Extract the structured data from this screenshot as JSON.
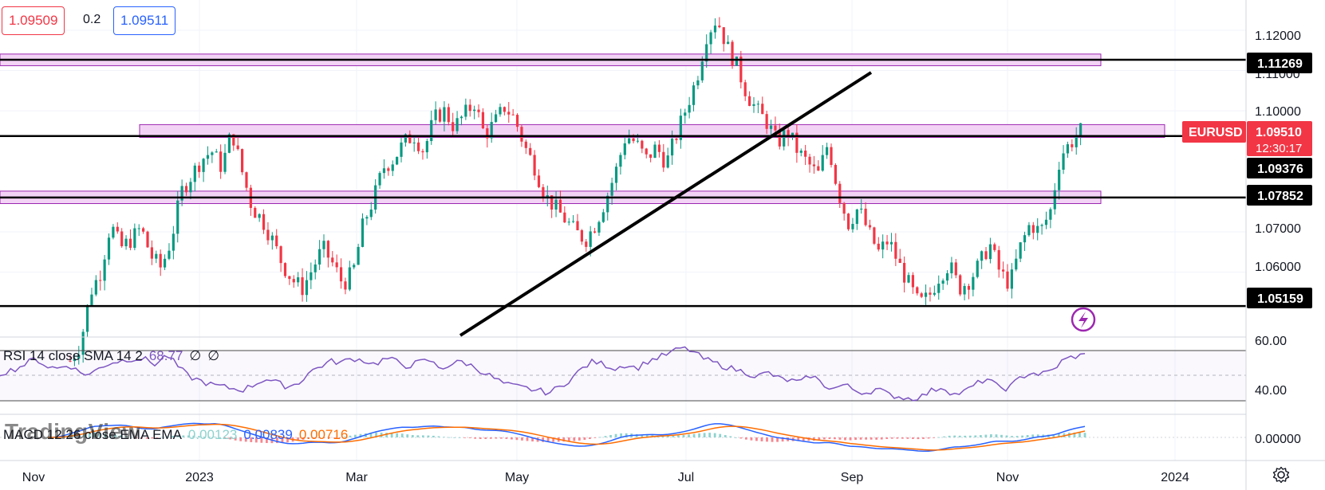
{
  "toolbar": {
    "sell_price": "1.09509",
    "spread": "0.2",
    "buy_price": "1.09511"
  },
  "price_axis": {
    "labels": [
      "1.12000",
      "1.11000",
      "1.10000",
      "1.07000",
      "1.06000"
    ],
    "levels": [
      {
        "value": "1.11269"
      },
      {
        "value": "1.09376"
      },
      {
        "value": "1.07852"
      },
      {
        "value": "1.05159"
      }
    ],
    "symbol_tag": "EURUSD",
    "current_price": "1.09510",
    "countdown": "12:30:17"
  },
  "time_axis": {
    "labels": [
      "Nov",
      "2023",
      "Mar",
      "May",
      "Jul",
      "Sep",
      "Nov",
      "2024"
    ]
  },
  "rsi": {
    "title": "RSI 14 close SMA 14 2",
    "value": "68.77",
    "extra1": "∅",
    "extra2": "∅",
    "axis_labels": [
      "60.00",
      "40.00"
    ]
  },
  "macd": {
    "title": "MACD 12 26 close EMA EMA",
    "hist_value": "0.00123",
    "macd_value": "0.00839",
    "signal_value": "0.00716",
    "axis_labels": [
      "0.00000"
    ]
  },
  "watermark": "TradingView",
  "colors": {
    "up": "#089981",
    "down": "#f23645",
    "zone_fill": "#f3d3f5",
    "zone_border": "#9c27b0",
    "rsi_line": "#7e57c2",
    "macd_line": "#2962ff",
    "signal_line": "#ff6d00",
    "price_tag": "#f23645",
    "level_tag": "#000000"
  },
  "chart_data": {
    "type": "candlestick",
    "symbol": "EURUSD",
    "price_range": [
      1.0445,
      1.1275
    ],
    "x": [
      "Nov",
      "2023",
      "Mar",
      "May",
      "Jul",
      "Sep",
      "Nov",
      "2024"
    ],
    "close_path": [
      1.038,
      1.042,
      1.055,
      1.06,
      1.072,
      1.066,
      1.068,
      1.071,
      1.064,
      1.061,
      1.068,
      1.08,
      1.084,
      1.088,
      1.09,
      1.086,
      1.095,
      1.085,
      1.076,
      1.073,
      1.068,
      1.062,
      1.058,
      1.056,
      1.061,
      1.066,
      1.062,
      1.057,
      1.06,
      1.072,
      1.078,
      1.086,
      1.088,
      1.092,
      1.094,
      1.09,
      1.098,
      1.1,
      1.096,
      1.099,
      1.102,
      1.094,
      1.097,
      1.101,
      1.098,
      1.091,
      1.086,
      1.079,
      1.076,
      1.073,
      1.07,
      1.068,
      1.072,
      1.078,
      1.085,
      1.094,
      1.092,
      1.088,
      1.091,
      1.087,
      1.094,
      1.101,
      1.108,
      1.119,
      1.123,
      1.116,
      1.111,
      1.104,
      1.1,
      1.097,
      1.092,
      1.095,
      1.09,
      1.087,
      1.084,
      1.092,
      1.08,
      1.072,
      1.076,
      1.07,
      1.065,
      1.068,
      1.062,
      1.057,
      1.052,
      1.054,
      1.059,
      1.062,
      1.056,
      1.058,
      1.062,
      1.067,
      1.06,
      1.057,
      1.066,
      1.072,
      1.07,
      1.075,
      1.089,
      1.092,
      1.095
    ],
    "levels": [
      1.11269,
      1.09376,
      1.07852,
      1.05159
    ],
    "zones": [
      {
        "low": 1.1118,
        "high": 1.1135
      },
      {
        "low": 1.094,
        "high": 1.096
      },
      {
        "low": 1.0776,
        "high": 1.0795
      }
    ],
    "rsi": {
      "range": [
        20,
        80
      ],
      "value": 68.77,
      "path": [
        48,
        52,
        55,
        60,
        66,
        58,
        56,
        60,
        52,
        50,
        58,
        62,
        64,
        66,
        65,
        60,
        70,
        58,
        48,
        44,
        40,
        38,
        36,
        35,
        40,
        46,
        42,
        38,
        41,
        52,
        58,
        63,
        62,
        66,
        64,
        60,
        66,
        63,
        58,
        62,
        64,
        56,
        60,
        63,
        58,
        52,
        46,
        40,
        38,
        36,
        34,
        32,
        38,
        46,
        56,
        63,
        60,
        56,
        60,
        56,
        63,
        67,
        71,
        76,
        74,
        66,
        62,
        58,
        55,
        52,
        48,
        52,
        46,
        44,
        42,
        50,
        40,
        36,
        40,
        34,
        32,
        36,
        30,
        28,
        26,
        28,
        34,
        38,
        30,
        33,
        40,
        46,
        38,
        36,
        46,
        52,
        50,
        54,
        64,
        68,
        69
      ]
    },
    "macd": {
      "range": [
        -0.014,
        0.017
      ],
      "macd": 0.00839,
      "signal": 0.00716,
      "histogram": 0.00123
    },
    "last_price": 1.0951
  }
}
